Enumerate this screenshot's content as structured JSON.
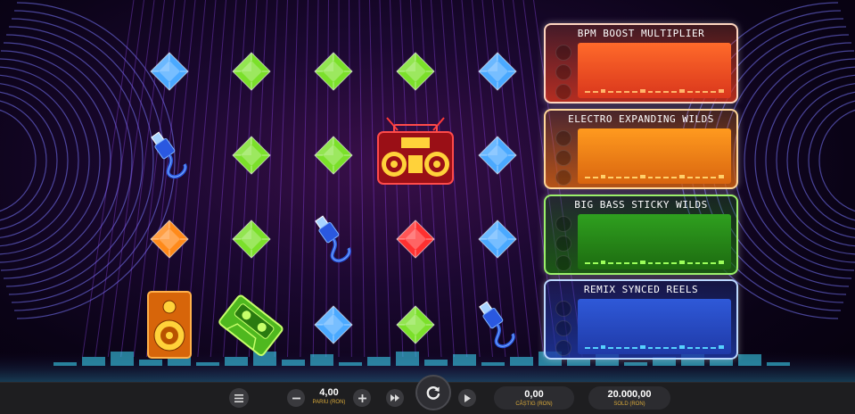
{
  "panels": [
    {
      "title": "BPM BOOST MULTIPLIER",
      "border": "#ffd6c0",
      "from": "#d9361c",
      "to": "#ff6a2a",
      "bar": "#ffb46a"
    },
    {
      "title": "ELECTRO EXPANDING WILDS",
      "border": "#ffd79a",
      "from": "#d9650f",
      "to": "#ff9a1f",
      "bar": "#ffd06a"
    },
    {
      "title": "BIG BASS STICKY WILDS",
      "border": "#9bf06a",
      "from": "#1d6b10",
      "to": "#2fa01f",
      "bar": "#9cff5a"
    },
    {
      "title": "REMIX SYNCED REELS",
      "border": "#bcd8ff",
      "from": "#1f3aa8",
      "to": "#2f59d8",
      "bar": "#56d2ff"
    }
  ],
  "reels": [
    [
      "blue-gem",
      "green-gem",
      "green-gem",
      "green-gem",
      "blue-gem"
    ],
    [
      "cable-plug",
      "green-gem",
      "green-gem",
      "boombox",
      "blue-gem"
    ],
    [
      "orange-gem",
      "green-gem",
      "cable-plug",
      "red-gem",
      "blue-gem"
    ],
    [
      "speaker",
      "cassette",
      "blue-gem",
      "green-gem",
      "cable-plug"
    ]
  ],
  "colors": {
    "blue-gem": "#4aa9ff",
    "green-gem": "#7be02a",
    "orange-gem": "#ff8a1a",
    "red-gem": "#ff3030"
  },
  "controls": {
    "bet_value": "4,00",
    "bet_label": "PARIU (RON)",
    "win_value": "0,00",
    "win_label": "CÂȘTIG (RON)",
    "balance_value": "20.000,00",
    "balance_label": "SOLD (RON)"
  },
  "icons": {
    "menu": "hamburger-icon",
    "minus": "minus-icon",
    "plus": "plus-icon",
    "turbo": "fast-forward-icon",
    "spin": "spin-arrow-icon",
    "autoplay": "play-icon"
  }
}
